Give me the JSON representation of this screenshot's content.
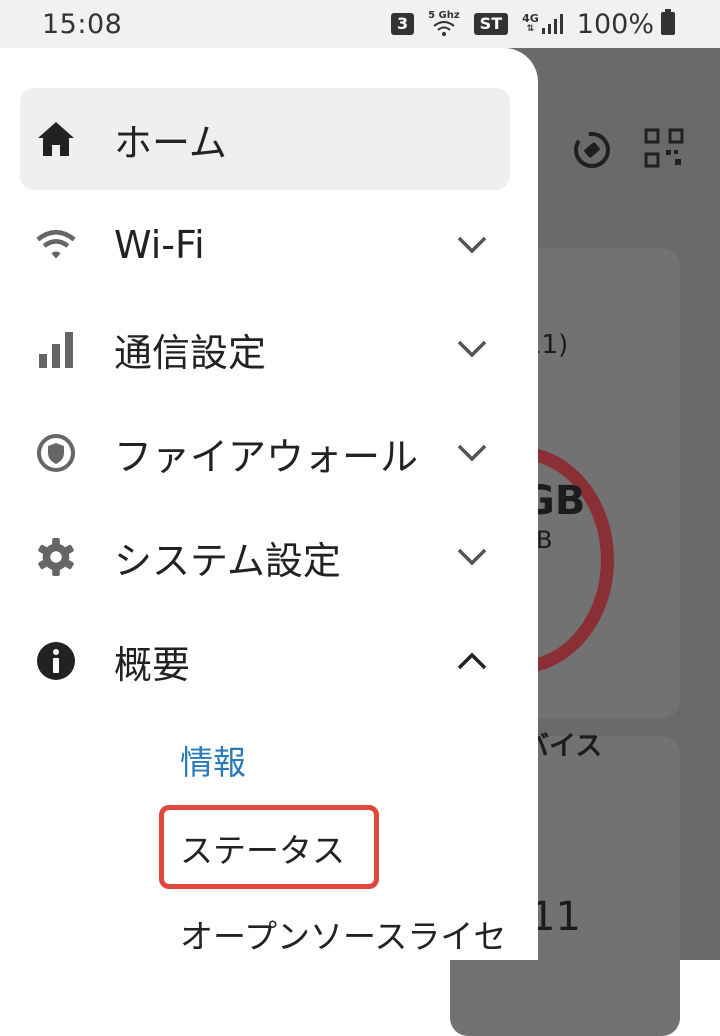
{
  "status_bar": {
    "time": "15:08",
    "notif_count": "3",
    "wifi_band": "5 Ghz",
    "st_badge": "ST",
    "network": "4G",
    "battery": "100%"
  },
  "background": {
    "value_fragment": "11)",
    "gb_main": "GB",
    "gb_sub": "B",
    "device_fragment": "バイス",
    "num_fragment": "11"
  },
  "drawer": {
    "items": [
      {
        "label": "ホーム",
        "icon": "home-icon",
        "active": true
      },
      {
        "label": "Wi-Fi",
        "icon": "wifi-icon",
        "expanded": false
      },
      {
        "label": "通信設定",
        "icon": "signal-bars-icon",
        "expanded": false
      },
      {
        "label": "ファイアウォール",
        "icon": "shield-icon",
        "expanded": false
      },
      {
        "label": "システム設定",
        "icon": "gear-icon",
        "expanded": false
      },
      {
        "label": "概要",
        "icon": "info-icon",
        "expanded": true
      }
    ],
    "sub_items": [
      {
        "label": "情報",
        "selected": true
      },
      {
        "label": "ステータス",
        "highlighted": true
      },
      {
        "label": "オープンソースライセ"
      }
    ]
  },
  "colors": {
    "accent": "#2a7ab8",
    "highlight": "#e0483e",
    "ring": "#8b2f36"
  }
}
